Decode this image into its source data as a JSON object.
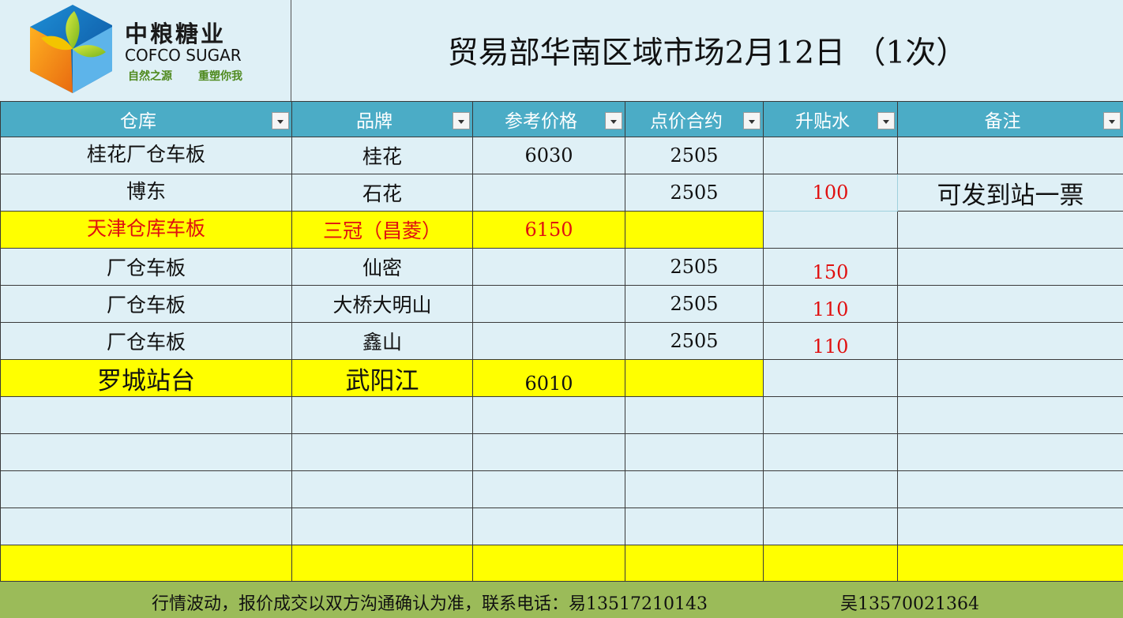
{
  "brand": {
    "name_cn": "中粮糖业",
    "name_en": "COFCO SUGAR",
    "slogan_1": "自然之源",
    "slogan_2": "重塑你我"
  },
  "title": "贸易部华南区域市场2月12日 （1次）",
  "headers": [
    "仓库",
    "品牌",
    "参考价格",
    "点价合约",
    "升贴水",
    "备注"
  ],
  "rows": [
    {
      "warehouse": "桂花厂仓车板",
      "brand": "桂花",
      "price": "6030",
      "contract": "2505",
      "premium": "",
      "note": ""
    },
    {
      "warehouse": "博东",
      "brand": "石花",
      "price": "",
      "contract": "2505",
      "premium": "100",
      "note": "可发到站一票"
    },
    {
      "warehouse": "天津仓库车板",
      "brand": "三冠（昌菱）",
      "price": "6150",
      "contract": "",
      "premium": "",
      "note": ""
    },
    {
      "warehouse": "厂仓车板",
      "brand": "仙密",
      "price": "",
      "contract": "2505",
      "premium": "150",
      "note": ""
    },
    {
      "warehouse": "厂仓车板",
      "brand": "大桥大明山",
      "price": "",
      "contract": "2505",
      "premium": "110",
      "note": ""
    },
    {
      "warehouse": "厂仓车板",
      "brand": "鑫山",
      "price": "",
      "contract": "2505",
      "premium": "110",
      "note": ""
    },
    {
      "warehouse": "罗城站台",
      "brand": "武阳江",
      "price": "6010",
      "contract": "",
      "premium": "",
      "note": ""
    }
  ],
  "footer": {
    "text": "行情波动，报价成交以双方沟通确认为准，联系电话：易13517210143",
    "contact_2": "吴13570021364"
  },
  "colors": {
    "header_bg": "#4bacc6",
    "sheet_bg": "#dff0f6",
    "highlight": "#ffff00",
    "footer_bg": "#9bbb59",
    "premium_text": "#e01010"
  }
}
